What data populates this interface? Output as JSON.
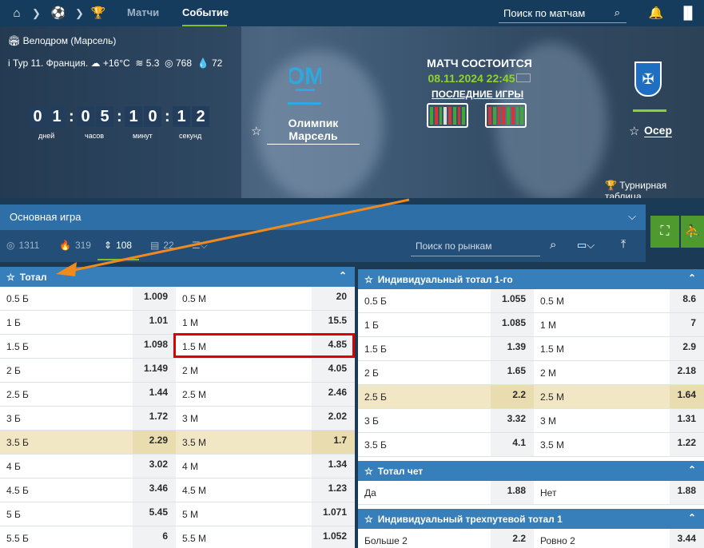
{
  "nav": {
    "tab_matches": "Матчи",
    "tab_event": "Событие",
    "search_placeholder": "Поиск по матчам"
  },
  "event": {
    "stadium": "Велодром (Марсель)",
    "round": "Тур 11. Франция.",
    "temp": "+16°C",
    "wind": "5.3",
    "pressure": "768",
    "humidity": "72"
  },
  "countdown": {
    "digits": [
      "0",
      "1",
      "0",
      "5",
      "1",
      "0",
      "1",
      "2"
    ],
    "labels": [
      "дней",
      "часов",
      "минут",
      "секунд"
    ]
  },
  "match": {
    "status": "МАТЧ СОСТОИТСЯ",
    "date": "08.11.2024 22:45",
    "last_games": "ПОСЛЕДНИЕ ИГРЫ",
    "team1_line1": "Олимпик",
    "team1_line2": "Марсель",
    "team2": "Осер",
    "standings": "Турнирная таблица"
  },
  "markets": {
    "main_game": "Основная игра",
    "search_placeholder": "Поиск по рынкам",
    "filters": [
      {
        "label": "1311",
        "icon": "target-icon"
      },
      {
        "label": "319",
        "icon": "fire-icon"
      },
      {
        "label": "108",
        "icon": "sort-icon"
      },
      {
        "label": "22",
        "icon": "bars-icon"
      }
    ]
  },
  "total": {
    "title": "Тотал",
    "rows": [
      [
        "0.5 Б",
        "1.009",
        "0.5 М",
        "20"
      ],
      [
        "1 Б",
        "1.01",
        "1 М",
        "15.5"
      ],
      [
        "1.5 Б",
        "1.098",
        "1.5 М",
        "4.85"
      ],
      [
        "2 Б",
        "1.149",
        "2 М",
        "4.05"
      ],
      [
        "2.5 Б",
        "1.44",
        "2.5 М",
        "2.46"
      ],
      [
        "3 Б",
        "1.72",
        "3 М",
        "2.02"
      ],
      [
        "3.5 Б",
        "2.29",
        "3.5 М",
        "1.7"
      ],
      [
        "4 Б",
        "3.02",
        "4 М",
        "1.34"
      ],
      [
        "4.5 Б",
        "3.46",
        "4.5 М",
        "1.23"
      ],
      [
        "5 Б",
        "5.45",
        "5 М",
        "1.071"
      ],
      [
        "5.5 Б",
        "6",
        "5.5 М",
        "1.052"
      ]
    ]
  },
  "ind_total": {
    "title": "Индивидуальный тотал 1-го",
    "rows": [
      [
        "0.5 Б",
        "1.055",
        "0.5 М",
        "8.6"
      ],
      [
        "1 Б",
        "1.085",
        "1 М",
        "7"
      ],
      [
        "1.5 Б",
        "1.39",
        "1.5 М",
        "2.9"
      ],
      [
        "2 Б",
        "1.65",
        "2 М",
        "2.18"
      ],
      [
        "2.5 Б",
        "2.2",
        "2.5 М",
        "1.64"
      ],
      [
        "3 Б",
        "3.32",
        "3 М",
        "1.31"
      ],
      [
        "3.5 Б",
        "4.1",
        "3.5 М",
        "1.22"
      ]
    ]
  },
  "even": {
    "title": "Тотал чет",
    "rows": [
      [
        "Да",
        "1.88",
        "Нет",
        "1.88"
      ]
    ]
  },
  "ind3": {
    "title": "Индивидуальный трехпутевой тотал 1",
    "rows": [
      [
        "Больше 2",
        "2.2",
        "Ровно 2",
        "3.44"
      ]
    ]
  }
}
